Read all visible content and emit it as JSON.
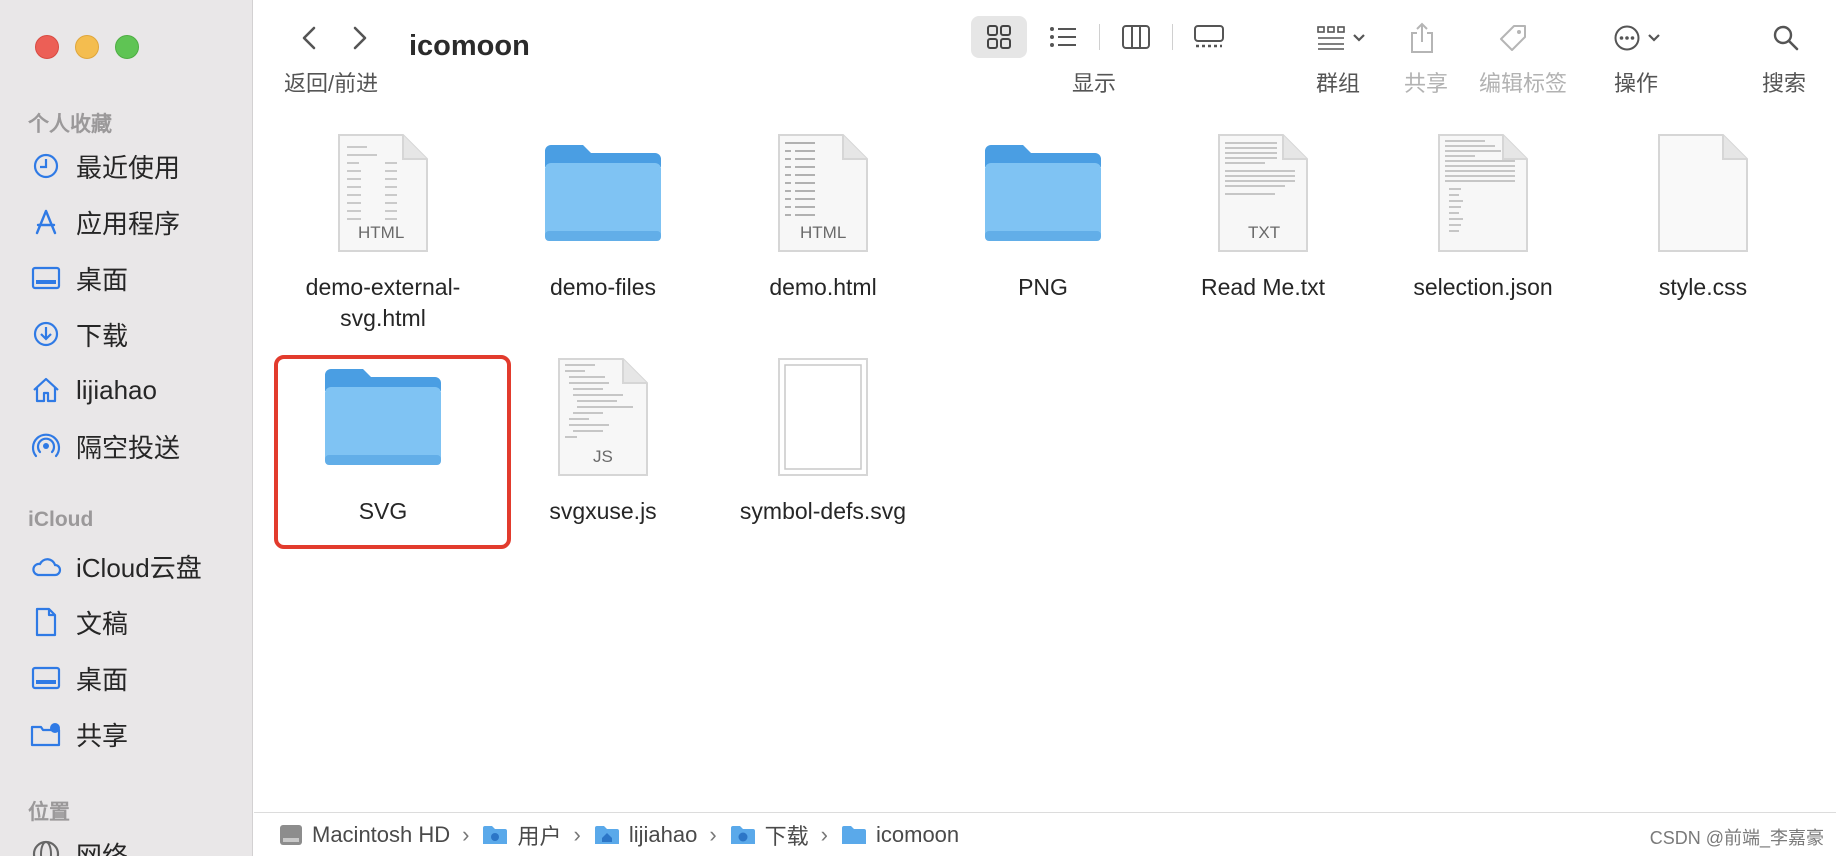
{
  "sidebar": {
    "favorites_title": "个人收藏",
    "favorites": [
      {
        "label": "最近使用",
        "icon": "clock-icon"
      },
      {
        "label": "应用程序",
        "icon": "apps-icon"
      },
      {
        "label": "桌面",
        "icon": "desktop-icon"
      },
      {
        "label": "下载",
        "icon": "download-icon"
      },
      {
        "label": "lijiahao",
        "icon": "home-icon"
      },
      {
        "label": "隔空投送",
        "icon": "airdrop-icon"
      }
    ],
    "icloud_title": "iCloud",
    "icloud": [
      {
        "label": "iCloud云盘",
        "icon": "cloud-icon"
      },
      {
        "label": "文稿",
        "icon": "document-icon"
      },
      {
        "label": "桌面",
        "icon": "desktop-icon"
      },
      {
        "label": "共享",
        "icon": "shared-folder-icon"
      }
    ],
    "locations_title": "位置",
    "locations": [
      {
        "label": "网络",
        "icon": "network-icon"
      }
    ]
  },
  "toolbar": {
    "title": "icomoon",
    "nav_label": "返回/前进",
    "view_label": "显示",
    "group_label": "群组",
    "share_label": "共享",
    "tags_label": "编辑标签",
    "action_label": "操作",
    "search_label": "搜索"
  },
  "files": [
    {
      "name": "demo-external-svg.html",
      "line1": "demo-external-",
      "line2": "svg.html",
      "kind": "doc",
      "badge": "HTML"
    },
    {
      "name": "demo-files",
      "line1": "demo-files",
      "line2": "",
      "kind": "folder",
      "badge": ""
    },
    {
      "name": "demo.html",
      "line1": "demo.html",
      "line2": "",
      "kind": "doc",
      "badge": "HTML"
    },
    {
      "name": "PNG",
      "line1": "PNG",
      "line2": "",
      "kind": "folder",
      "badge": ""
    },
    {
      "name": "Read Me.txt",
      "line1": "Read Me.txt",
      "line2": "",
      "kind": "doc",
      "badge": "TXT"
    },
    {
      "name": "selection.json",
      "line1": "selection.json",
      "line2": "",
      "kind": "doc",
      "badge": ""
    },
    {
      "name": "style.css",
      "line1": "style.css",
      "line2": "",
      "kind": "blank",
      "badge": ""
    },
    {
      "name": "SVG",
      "line1": "SVG",
      "line2": "",
      "kind": "folder",
      "badge": ""
    },
    {
      "name": "svgxuse.js",
      "line1": "svgxuse.js",
      "line2": "",
      "kind": "doc",
      "badge": "JS"
    },
    {
      "name": "symbol-defs.svg",
      "line1": "symbol-defs.svg",
      "line2": "",
      "kind": "svg",
      "badge": ""
    }
  ],
  "pathbar": [
    {
      "label": "Macintosh HD",
      "icon": "disk-icon"
    },
    {
      "label": "用户",
      "icon": "folder-users-icon"
    },
    {
      "label": "lijiahao",
      "icon": "folder-home-icon"
    },
    {
      "label": "下载",
      "icon": "folder-download-icon"
    },
    {
      "label": "icomoon",
      "icon": "folder-icon"
    }
  ],
  "watermark": "CSDN @前端_李嘉豪",
  "colors": {
    "accent": "#2f7ae5",
    "selection_border": "#e23b2d",
    "folder": "#79bff2"
  }
}
